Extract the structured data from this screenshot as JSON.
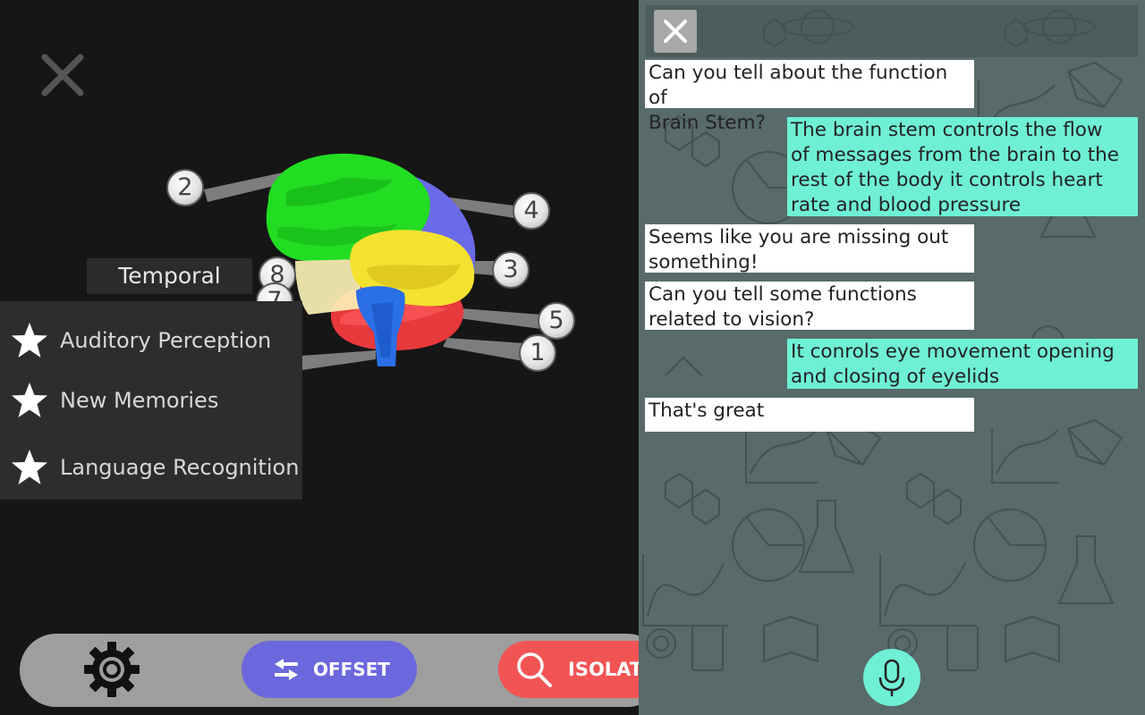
{
  "viewer": {
    "region_label": "Temporal",
    "markers": [
      "2",
      "4",
      "3",
      "8",
      "7",
      "5",
      "1"
    ],
    "functions": [
      {
        "label": "Auditory Perception",
        "icon": "star-icon"
      },
      {
        "label": "New Memories",
        "icon": "star-icon"
      },
      {
        "label": "Language Recognition",
        "icon": "star-icon"
      }
    ],
    "region_colors": {
      "frontal": "#22dd22",
      "parietal": "#6b6bea",
      "temporal": "#f4e230",
      "occipital": "#e8393c",
      "brain_stem": "#2a6fe6",
      "highlight": "#fff4b8"
    }
  },
  "toolbar": {
    "offset_label": "OFFSET",
    "isolate_label": "ISOLATE",
    "colors": {
      "offset": "#6b67dc",
      "isolate": "#f25454",
      "bar": "#9e9e9e"
    }
  },
  "chat": {
    "messages": [
      {
        "from": "user",
        "text": "Can you tell about the function of\nBrain Stem?"
      },
      {
        "from": "bot",
        "text": "The brain stem controls the flow\nof messages from the brain to the\nrest of the body it controls heart\nrate and blood pressure"
      },
      {
        "from": "user",
        "text": "Seems like you are missing out\nsomething!"
      },
      {
        "from": "user",
        "text": "Can you tell some functions\nrelated to vision?"
      },
      {
        "from": "bot",
        "text": "It conrols eye movement opening\nand closing of eyelids"
      },
      {
        "from": "user",
        "text": "That's great"
      }
    ],
    "colors": {
      "user_bubble": "#ffffff",
      "bot_bubble": "#6ff0d5",
      "background": "#586a6a"
    }
  }
}
